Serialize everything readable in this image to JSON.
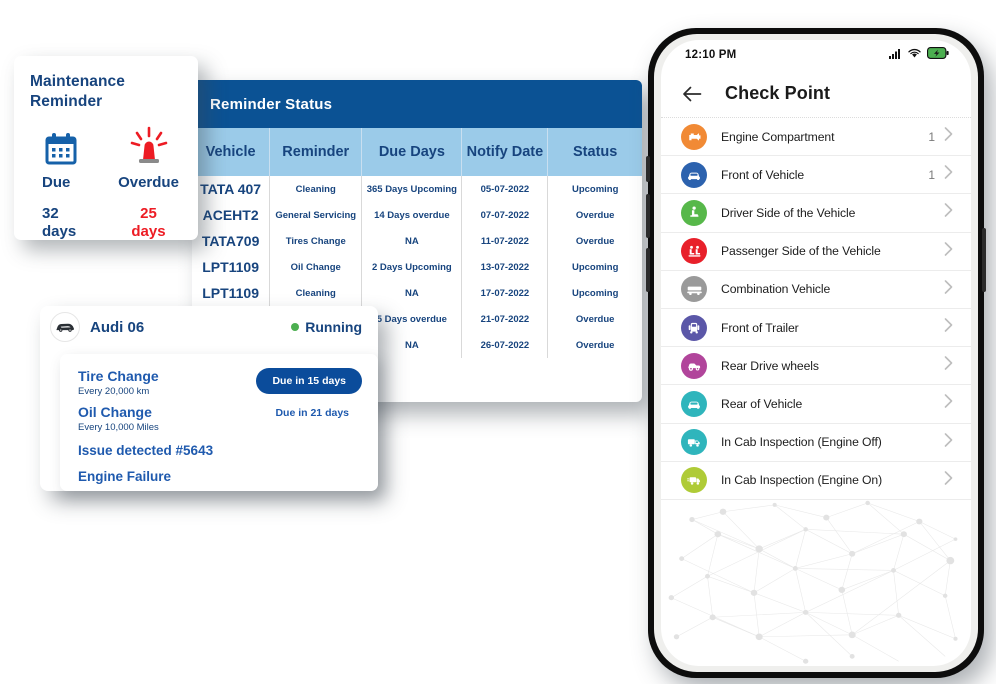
{
  "maintenance_card": {
    "title_line1": "Maintenance",
    "title_line2": "Reminder",
    "due": {
      "icon": "calendar-icon",
      "label": "Due",
      "value_line1": "32",
      "value_line2": "days",
      "color": "#17447E"
    },
    "overdue": {
      "icon": "alarm-beacon-icon",
      "label": "Overdue",
      "value_line1": "25",
      "value_line2": "days",
      "color": "#ED1C24"
    }
  },
  "reminder_table": {
    "title": "Reminder Status",
    "header_bg": "#0B5294",
    "columns_bg": "#9BCBE9",
    "text_color": "#17447E",
    "columns": [
      "Vehicle",
      "Reminder",
      "Due Days",
      "Notify Date",
      "Status"
    ],
    "rows": [
      {
        "vehicle": "TATA 407",
        "reminder": "Cleaning",
        "due_days": "365 Days Upcoming",
        "notify_date": "05-07-2022",
        "status": "Upcoming"
      },
      {
        "vehicle": "ACEHT2",
        "reminder": "General Servicing",
        "due_days": "14 Days overdue",
        "notify_date": "07-07-2022",
        "status": "Overdue"
      },
      {
        "vehicle": "TATA709",
        "reminder": "Tires Change",
        "due_days": "NA",
        "notify_date": "11-07-2022",
        "status": "Overdue"
      },
      {
        "vehicle": "LPT1109",
        "reminder": "Oil Change",
        "due_days": "2 Days Upcoming",
        "notify_date": "13-07-2022",
        "status": "Upcoming"
      },
      {
        "vehicle": "LPT1109",
        "reminder": "Cleaning",
        "due_days": "NA",
        "notify_date": "17-07-2022",
        "status": "Upcoming"
      },
      {
        "vehicle": "",
        "reminder": "",
        "due_days": "5 Days overdue",
        "notify_date": "21-07-2022",
        "status": "Overdue"
      },
      {
        "vehicle": "",
        "reminder": "",
        "due_days": "NA",
        "notify_date": "26-07-2022",
        "status": "Overdue"
      }
    ]
  },
  "vehicle_card": {
    "avatar_icon": "car-icon",
    "name": "Audi 06",
    "status": "Running",
    "status_color": "#4CAF50",
    "services": [
      {
        "name": "Tire Change",
        "interval": "Every 20,000 km",
        "due": "Due in 15 days",
        "highlight": true
      },
      {
        "name": "Oil Change",
        "interval": "Every 10,000 Miles",
        "due": "Due in 21 days",
        "highlight": false
      }
    ],
    "issue": "Issue detected #5643",
    "failure": "Engine Failure"
  },
  "phone": {
    "statusbar": {
      "time": "12:10 PM",
      "icons": [
        "signal-icon",
        "wifi-icon",
        "battery-icon"
      ],
      "battery_color": "#4CAF50"
    },
    "appbar": {
      "back_icon": "back-arrow-icon",
      "title": "Check Point"
    },
    "checkpoints": [
      {
        "label": "Engine Compartment",
        "count": "1",
        "icon": "engine-icon",
        "color": "#F18A35"
      },
      {
        "label": "Front of Vehicle",
        "count": "1",
        "icon": "car-front-icon",
        "color": "#2C62AE"
      },
      {
        "label": "Driver Side of the Vehicle",
        "count": "",
        "icon": "driver-seat-icon",
        "color": "#57B84A"
      },
      {
        "label": "Passenger Side of the Vehicle",
        "count": "",
        "icon": "passengers-icon",
        "color": "#E8202A"
      },
      {
        "label": "Combination Vehicle",
        "count": "",
        "icon": "combination-truck-icon",
        "color": "#9A9A9A"
      },
      {
        "label": "Front of Trailer",
        "count": "",
        "icon": "trailer-front-icon",
        "color": "#5B57A8"
      },
      {
        "label": "Rear Drive wheels",
        "count": "",
        "icon": "rear-wheels-icon",
        "color": "#B1459B"
      },
      {
        "label": "Rear of Vehicle",
        "count": "",
        "icon": "car-rear-icon",
        "color": "#2FB5BC"
      },
      {
        "label": "In Cab Inspection (Engine Off)",
        "count": "",
        "icon": "truck-off-icon",
        "color": "#2FB5BC"
      },
      {
        "label": "In Cab Inspection (Engine On)",
        "count": "",
        "icon": "truck-on-icon",
        "color": "#AFCB37"
      }
    ]
  }
}
